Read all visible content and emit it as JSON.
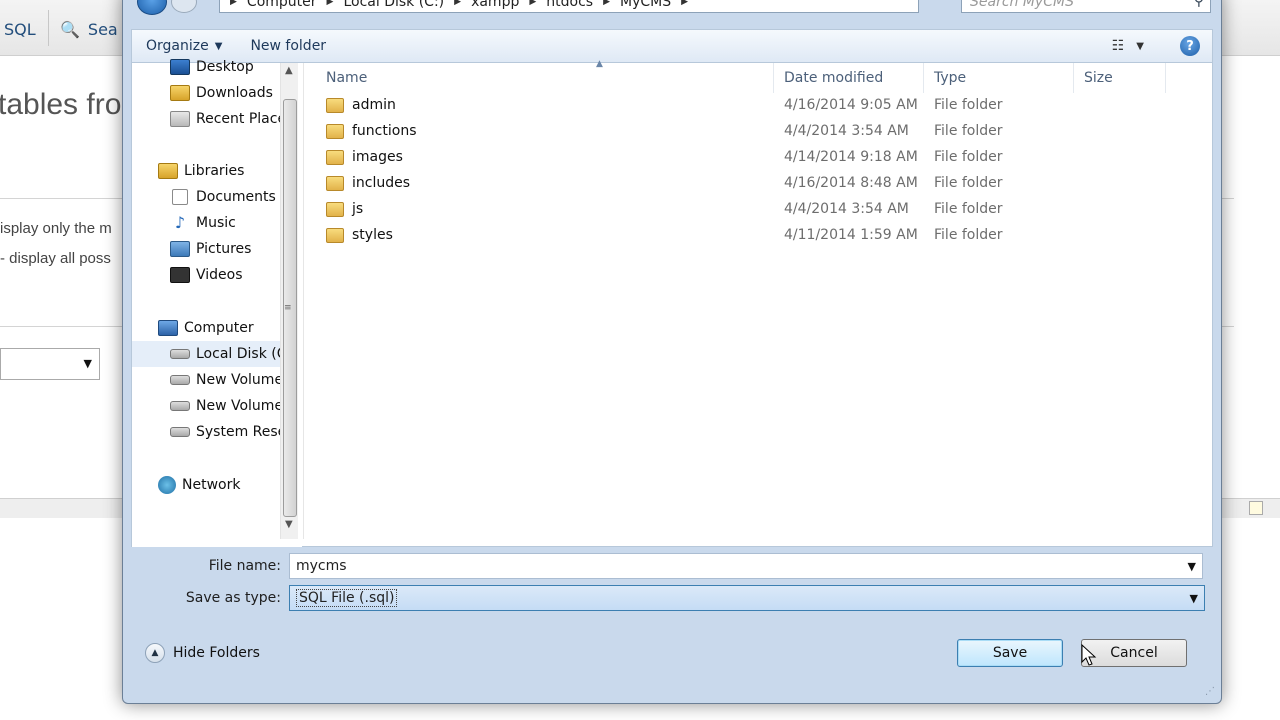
{
  "background": {
    "tabs": {
      "sql": "SQL",
      "search": "Sea"
    },
    "heading": "tables fro",
    "lines": {
      "line1": "isplay only the m",
      "line2": "- display all poss"
    }
  },
  "dialog": {
    "breadcrumb": [
      "Computer",
      "Local Disk (C:)",
      "xampp",
      "htdocs",
      "MyCMS"
    ],
    "search_placeholder": "Search MyCMS",
    "toolbar": {
      "organize": "Organize",
      "new_folder": "New folder",
      "help": "?"
    },
    "nav": {
      "favorites": [
        {
          "label": "Desktop",
          "icon": "desktop-icon"
        },
        {
          "label": "Downloads",
          "icon": "downloads-folder-icon"
        },
        {
          "label": "Recent Places",
          "icon": "recent-places-icon"
        }
      ],
      "libraries_label": "Libraries",
      "libraries": [
        {
          "label": "Documents",
          "icon": "documents-icon"
        },
        {
          "label": "Music",
          "icon": "music-icon"
        },
        {
          "label": "Pictures",
          "icon": "pictures-icon"
        },
        {
          "label": "Videos",
          "icon": "videos-icon"
        }
      ],
      "computer_label": "Computer",
      "drives": [
        {
          "label": "Local Disk (C:)",
          "icon": "local-disk-icon"
        },
        {
          "label": "New Volume",
          "icon": "drive-icon"
        },
        {
          "label": "New Volume",
          "icon": "drive-icon"
        },
        {
          "label": "System Reserved",
          "icon": "drive-icon"
        }
      ],
      "network_label": "Network"
    },
    "columns": {
      "name": "Name",
      "date": "Date modified",
      "type": "Type",
      "size": "Size"
    },
    "files": [
      {
        "name": "admin",
        "date": "4/16/2014 9:05 AM",
        "type": "File folder"
      },
      {
        "name": "functions",
        "date": "4/4/2014 3:54 AM",
        "type": "File folder"
      },
      {
        "name": "images",
        "date": "4/14/2014 9:18 AM",
        "type": "File folder"
      },
      {
        "name": "includes",
        "date": "4/16/2014 8:48 AM",
        "type": "File folder"
      },
      {
        "name": "js",
        "date": "4/4/2014 3:54 AM",
        "type": "File folder"
      },
      {
        "name": "styles",
        "date": "4/11/2014 1:59 AM",
        "type": "File folder"
      }
    ],
    "form": {
      "file_name_label": "File name:",
      "file_name_value": "mycms",
      "save_type_label": "Save as type:",
      "save_type_value": "SQL File (.sql)"
    },
    "hide_folders": "Hide Folders",
    "save_button": "Save",
    "cancel_button": "Cancel"
  }
}
